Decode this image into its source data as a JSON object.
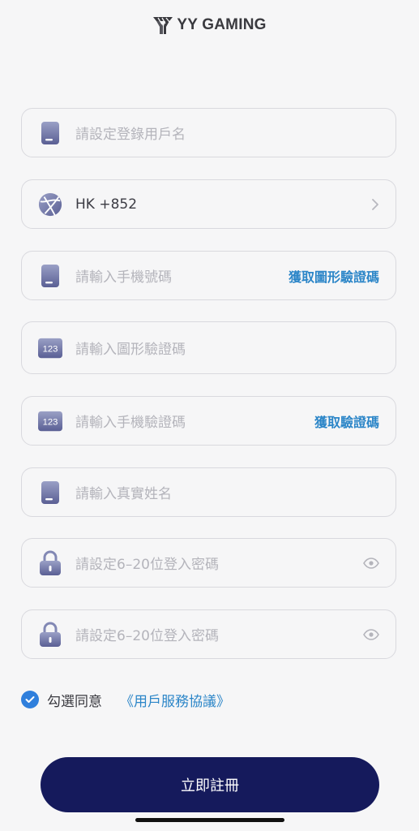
{
  "brand": {
    "name": "YY GAMING"
  },
  "form": {
    "username": {
      "placeholder": "請設定登錄用戶名",
      "icon": "phone-card-icon"
    },
    "region": {
      "value": "HK +852",
      "icon": "globe-icon"
    },
    "phone": {
      "placeholder": "請輸入手機號碼",
      "action": "獲取圖形驗證碼",
      "icon": "phone-card-icon"
    },
    "captcha": {
      "placeholder": "請輸入圖形驗證碼",
      "icon": "code-123-icon",
      "icon_text": "123"
    },
    "sms_code": {
      "placeholder": "請輸入手機驗證碼",
      "action": "獲取驗證碼",
      "icon": "code-123-icon",
      "icon_text": "123"
    },
    "real_name": {
      "placeholder": "請輸入真實姓名",
      "icon": "phone-card-icon"
    },
    "password": {
      "placeholder": "請設定6–20位登入密碼",
      "icon": "lock-icon"
    },
    "password_confirm": {
      "placeholder": "請設定6–20位登入密碼",
      "icon": "lock-icon"
    }
  },
  "agreement": {
    "text": "勾選同意",
    "link": "《用戶服務協議》",
    "checked": true
  },
  "submit": {
    "label": "立即註冊"
  },
  "colors": {
    "accent": "#2c86c8",
    "primary_button": "#151a5c",
    "check": "#2f7fdc"
  }
}
